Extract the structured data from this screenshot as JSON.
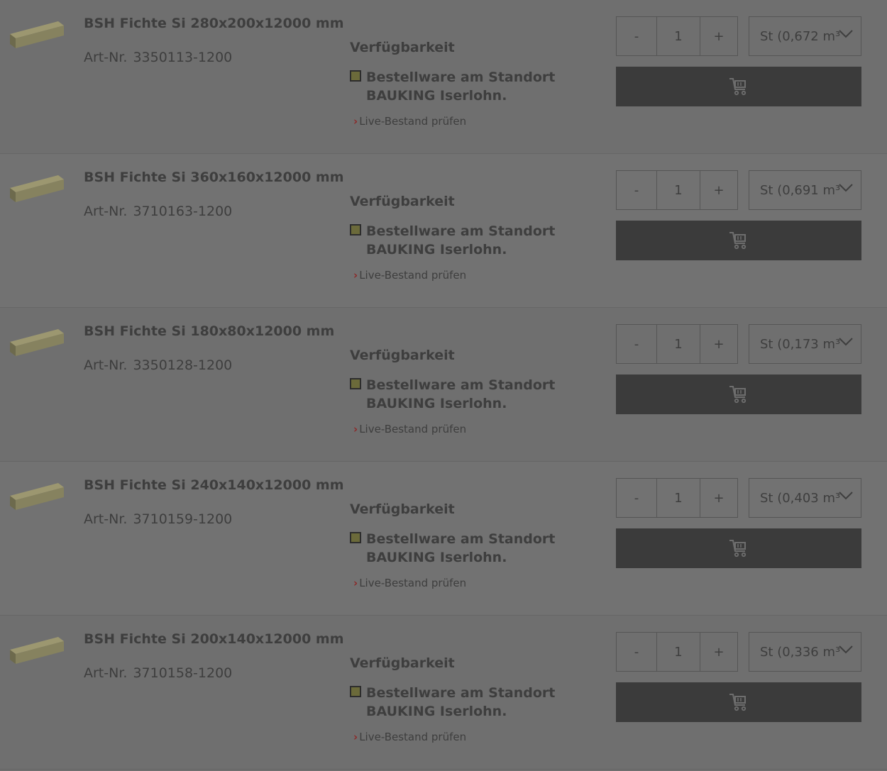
{
  "products": [
    {
      "title": "BSH Fichte Si 280x200x12000 mm",
      "artnr_label": "Art-Nr.",
      "artnr": "3350113-1200",
      "availability_heading": "Verfügbarkeit",
      "status": "Bestellware am Standort BAUKING Iserlohn.",
      "live_link": "Live-Bestand prüfen",
      "qty_minus": "-",
      "qty_value": "1",
      "qty_plus": "+",
      "unit": "St (0,672 m³"
    },
    {
      "title": "BSH Fichte Si 360x160x12000 mm",
      "artnr_label": "Art-Nr.",
      "artnr": "3710163-1200",
      "availability_heading": "Verfügbarkeit",
      "status": "Bestellware am Standort BAUKING Iserlohn.",
      "live_link": "Live-Bestand prüfen",
      "qty_minus": "-",
      "qty_value": "1",
      "qty_plus": "+",
      "unit": "St (0,691 m³"
    },
    {
      "title": "BSH Fichte Si 180x80x12000 mm",
      "artnr_label": "Art-Nr.",
      "artnr": "3350128-1200",
      "availability_heading": "Verfügbarkeit",
      "status": "Bestellware am Standort BAUKING Iserlohn.",
      "live_link": "Live-Bestand prüfen",
      "qty_minus": "-",
      "qty_value": "1",
      "qty_plus": "+",
      "unit": "St (0,173 m³"
    },
    {
      "title": "BSH Fichte Si 240x140x12000 mm",
      "artnr_label": "Art-Nr.",
      "artnr": "3710159-1200",
      "availability_heading": "Verfügbarkeit",
      "status": "Bestellware am Standort BAUKING Iserlohn.",
      "live_link": "Live-Bestand prüfen",
      "qty_minus": "-",
      "qty_value": "1",
      "qty_plus": "+",
      "unit": "St (0,403 m³"
    },
    {
      "title": "BSH Fichte Si 200x140x12000 mm",
      "artnr_label": "Art-Nr.",
      "artnr": "3710158-1200",
      "availability_heading": "Verfügbarkeit",
      "status": "Bestellware am Standort BAUKING Iserlohn.",
      "live_link": "Live-Bestand prüfen",
      "qty_minus": "-",
      "qty_value": "1",
      "qty_plus": "+",
      "unit": "St (0,336 m³"
    }
  ],
  "icons": {
    "cart": "add-to-cart-icon",
    "dropdown": "chevron-down-icon",
    "status": "status-square-icon",
    "live": "chevron-right-icon"
  },
  "colors": {
    "overlay_bg": "#6f6f6f",
    "text": "#3e3e3e",
    "button_bg": "#3b3b3b",
    "status_square": "#6b6a3a",
    "link_chevron": "#8c2a2a",
    "wood": "#8a8660"
  }
}
